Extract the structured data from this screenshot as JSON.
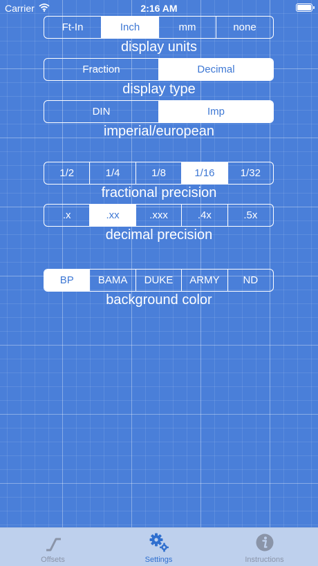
{
  "status_bar": {
    "carrier": "Carrier",
    "time": "2:16 AM"
  },
  "segments": [
    {
      "options": [
        "Ft-In",
        "Inch",
        "mm",
        "none"
      ],
      "selected_index": 1,
      "label": "display units"
    },
    {
      "options": [
        "Fraction",
        "Decimal"
      ],
      "selected_index": 1,
      "label": "display type"
    },
    {
      "options": [
        "DIN",
        "Imp"
      ],
      "selected_index": 1,
      "label": "imperial/european"
    },
    {
      "options": [
        "1/2",
        "1/4",
        "1/8",
        "1/16",
        "1/32"
      ],
      "selected_index": 3,
      "label": "fractional precision"
    },
    {
      "options": [
        ".x",
        ".xx",
        ".xxx",
        ".4x",
        ".5x"
      ],
      "selected_index": 1,
      "label": "decimal precision"
    },
    {
      "options": [
        "BP",
        "BAMA",
        "DUKE",
        "ARMY",
        "ND"
      ],
      "selected_index": 0,
      "label": "background color"
    }
  ],
  "tabbar": {
    "tabs": [
      {
        "label": "Offsets",
        "icon": "offset-icon"
      },
      {
        "label": "Settings",
        "icon": "gears-icon"
      },
      {
        "label": "Instructions",
        "icon": "info-icon"
      }
    ],
    "active_index": 1
  },
  "colors": {
    "background": "#4a7fd9",
    "selected_text": "#3e78d4",
    "tab_active": "#2f6fcf",
    "tabbar_bg": "#bed0ed"
  }
}
